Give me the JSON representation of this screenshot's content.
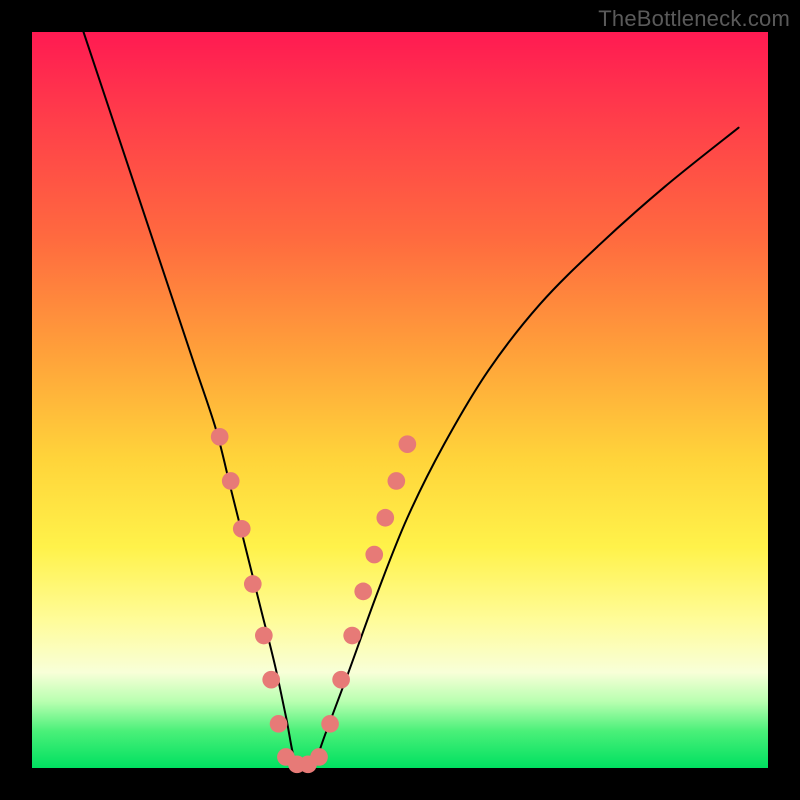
{
  "watermark": "TheBottleneck.com",
  "chart_data": {
    "type": "line",
    "title": "",
    "xlabel": "",
    "ylabel": "",
    "xlim": [
      0,
      100
    ],
    "ylim": [
      0,
      100
    ],
    "series": [
      {
        "name": "bottleneck-curve",
        "x": [
          7,
          10,
          13,
          16,
          19,
          22,
          25,
          27,
          29,
          31,
          33,
          34.5,
          36,
          38,
          40,
          43,
          47,
          51,
          56,
          62,
          69,
          77,
          86,
          96
        ],
        "values": [
          100,
          91,
          82,
          73,
          64,
          55,
          46,
          38,
          30,
          22,
          14,
          7,
          0,
          0,
          5,
          13,
          24,
          34,
          44,
          54,
          63,
          71,
          79,
          87
        ]
      }
    ],
    "markers": {
      "name": "highlight-dots",
      "color": "#e77a77",
      "radius_pct": 1.2,
      "points_xy": [
        [
          25.5,
          45
        ],
        [
          27,
          39
        ],
        [
          28.5,
          32.5
        ],
        [
          30,
          25
        ],
        [
          31.5,
          18
        ],
        [
          32.5,
          12
        ],
        [
          33.5,
          6
        ],
        [
          34.5,
          1.5
        ],
        [
          36,
          0.5
        ],
        [
          37.5,
          0.5
        ],
        [
          39,
          1.5
        ],
        [
          40.5,
          6
        ],
        [
          42,
          12
        ],
        [
          43.5,
          18
        ],
        [
          45,
          24
        ],
        [
          46.5,
          29
        ],
        [
          48,
          34
        ],
        [
          49.5,
          39
        ],
        [
          51,
          44
        ]
      ]
    }
  }
}
